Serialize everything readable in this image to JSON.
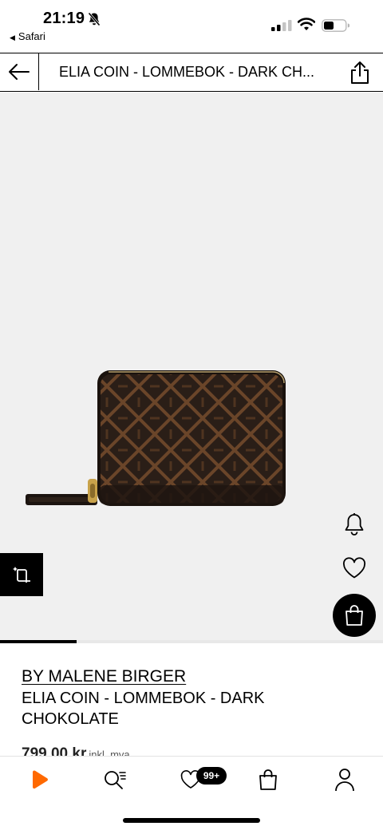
{
  "status_bar": {
    "time": "21:19",
    "back_app": "Safari",
    "back_glyph": "◀"
  },
  "header": {
    "title": "ELIA COIN - LOMMEBOK - DARK CH..."
  },
  "gallery": {
    "progress": 0.2
  },
  "product": {
    "brand": "BY MALENE BIRGER",
    "name": "ELIA COIN - LOMMEBOK - DARK CHOKOLATE",
    "price": "799,00 kr",
    "price_note": "inkl. mva."
  },
  "bottom_nav": {
    "wishlist_badge": "99+"
  },
  "colors": {
    "accent": "#ff6900",
    "gallery_bg": "#f0f0f0",
    "wallet": "#2a1e17",
    "wallet_pattern": "#6a4529",
    "zipper_gold": "#c8a24a"
  },
  "icons": {
    "status": [
      "bell-slash-icon",
      "cellular-signal-icon",
      "wifi-icon",
      "battery-icon"
    ],
    "header": [
      "back-arrow-icon",
      "share-icon"
    ],
    "gallery": [
      "bell-icon",
      "heart-icon",
      "shopping-bag-icon",
      "size-fit-icon"
    ],
    "nav": [
      "home-logo-icon",
      "search-icon",
      "heart-icon",
      "shopping-bag-icon",
      "user-icon"
    ]
  }
}
